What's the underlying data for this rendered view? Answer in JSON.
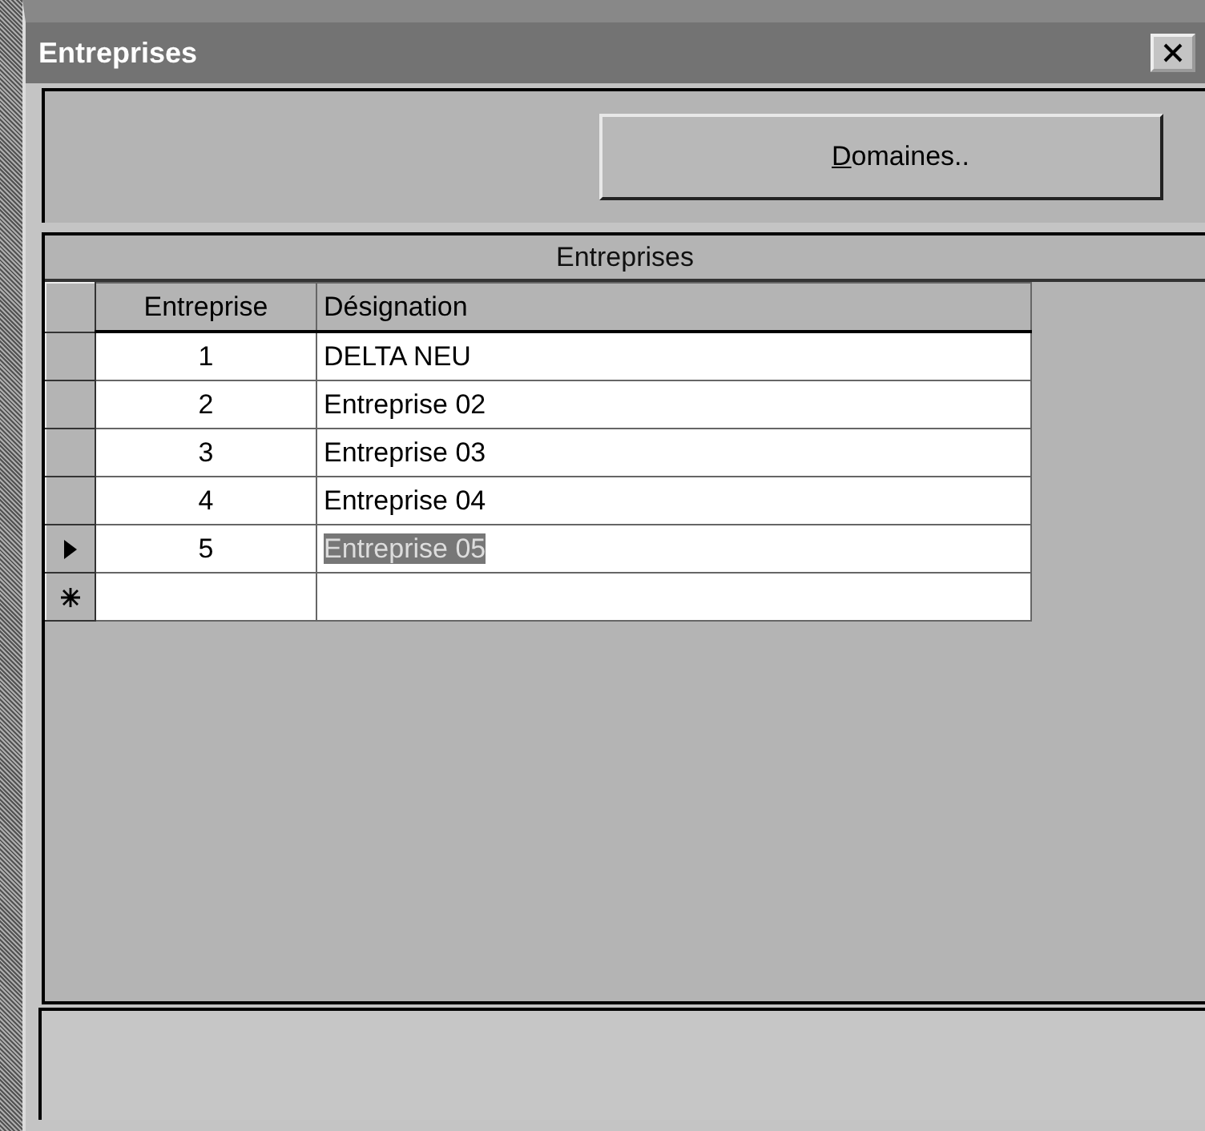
{
  "window": {
    "title": "Entreprises"
  },
  "toolbar": {
    "button": "Domaines.."
  },
  "grid": {
    "caption": "Entreprises",
    "columns": [
      "Entreprise",
      "Désignation"
    ],
    "rows": [
      {
        "kind": "record",
        "cells": [
          "1",
          "DELTA NEU"
        ],
        "selected": false
      },
      {
        "kind": "record",
        "cells": [
          "2",
          "Entreprise 02"
        ],
        "selected": false
      },
      {
        "kind": "record",
        "cells": [
          "3",
          "Entreprise 03"
        ],
        "selected": false
      },
      {
        "kind": "record",
        "cells": [
          "4",
          "Entreprise 04"
        ],
        "selected": false
      },
      {
        "kind": "record",
        "cells": [
          "5",
          "Entreprise 05"
        ],
        "selected": true
      },
      {
        "kind": "new",
        "cells": [
          "",
          ""
        ],
        "selected": false
      }
    ]
  }
}
